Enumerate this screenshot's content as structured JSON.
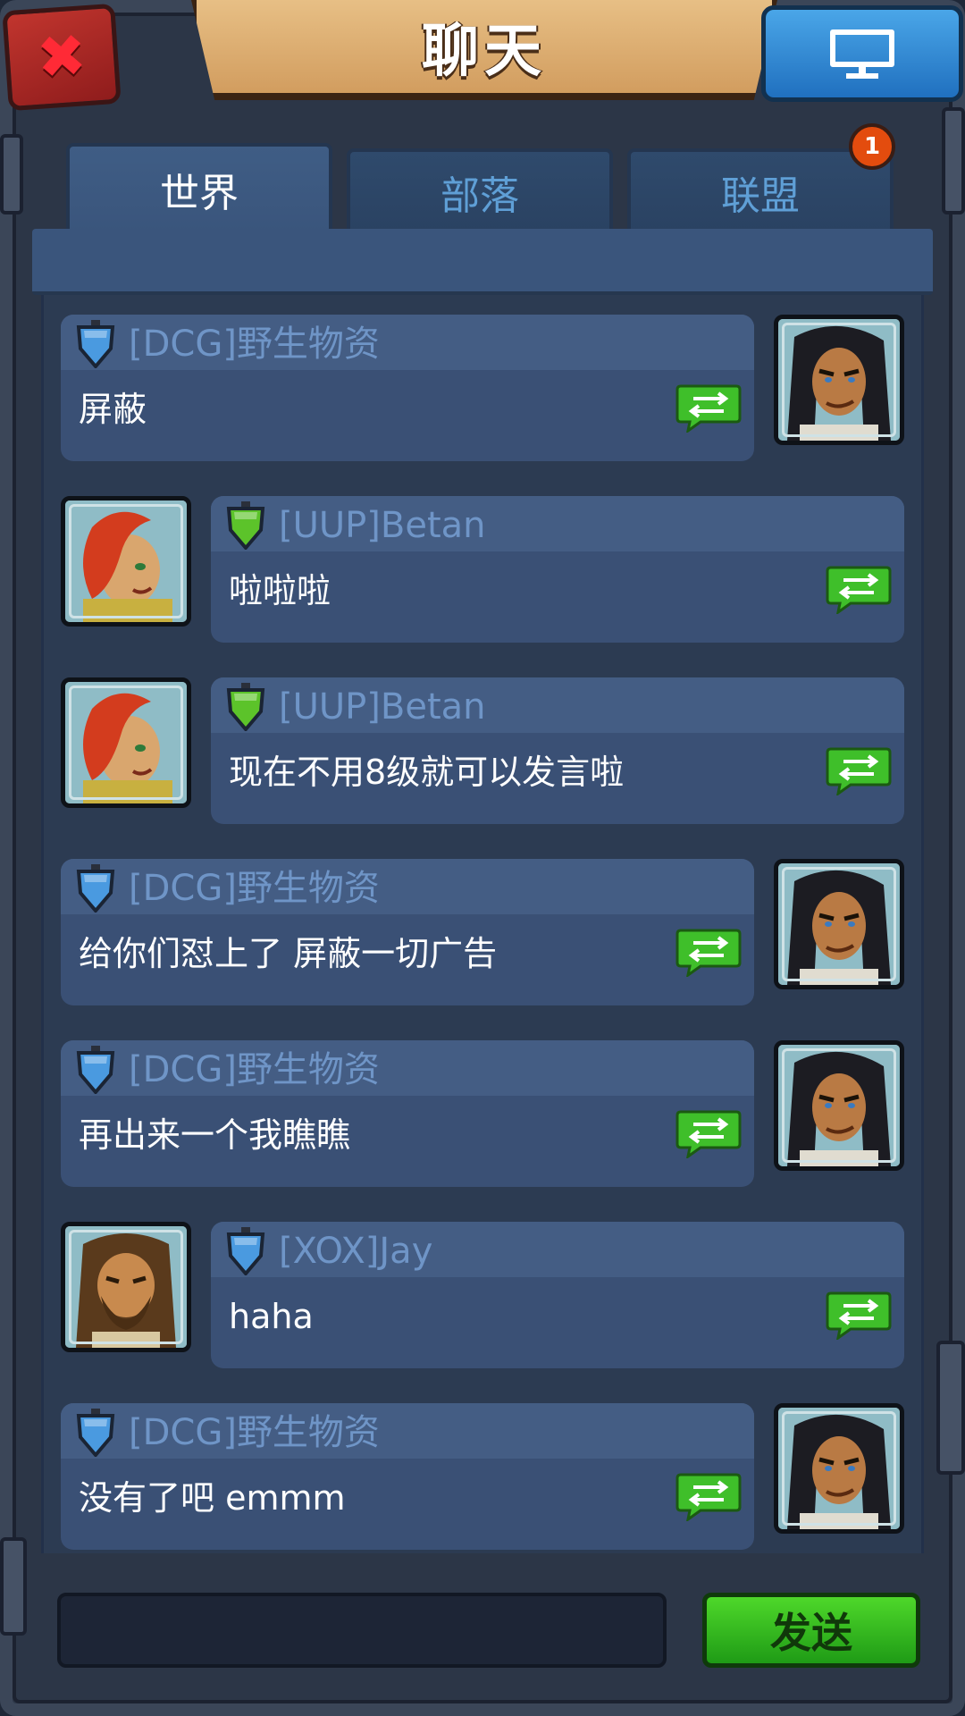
{
  "header": {
    "title": "聊天",
    "close_icon": "close-icon",
    "monitor_icon": "monitor-icon"
  },
  "tabs": [
    {
      "label": "世界",
      "active": true
    },
    {
      "label": "部落",
      "active": false
    },
    {
      "label": "联盟",
      "active": false,
      "badge": "1"
    }
  ],
  "messages": [
    {
      "side": "left-bubble",
      "name": "[DCG]野生物资",
      "text": "屏蔽",
      "shield_color": "#4a9ae0",
      "avatar": "dark-hair-warrior-avatar"
    },
    {
      "side": "right-bubble",
      "name": "[UUP]Betan",
      "text": "啦啦啦",
      "shield_color": "#5cc32a",
      "avatar": "red-hair-woman-avatar"
    },
    {
      "side": "right-bubble",
      "name": "[UUP]Betan",
      "text": "现在不用8级就可以发言啦",
      "shield_color": "#5cc32a",
      "avatar": "red-hair-woman-avatar"
    },
    {
      "side": "left-bubble",
      "name": "[DCG]野生物资",
      "text": "给你们怼上了 屏蔽一切广告",
      "shield_color": "#4a9ae0",
      "avatar": "dark-hair-warrior-avatar"
    },
    {
      "side": "left-bubble",
      "name": "[DCG]野生物资",
      "text": "再出来一个我瞧瞧",
      "shield_color": "#4a9ae0",
      "avatar": "dark-hair-warrior-avatar"
    },
    {
      "side": "right-bubble",
      "name": "[XOX]Jay",
      "text": "haha",
      "shield_color": "#4a9ae0",
      "avatar": "bearded-barbarian-avatar"
    },
    {
      "side": "left-bubble",
      "name": "[DCG]野生物资",
      "text": "没有了吧   emmm",
      "shield_color": "#4a9ae0",
      "avatar": "dark-hair-warrior-avatar"
    }
  ],
  "input": {
    "value": "",
    "placeholder": ""
  },
  "send_button": {
    "label": "发送"
  },
  "colors": {
    "bubble_bg": "#3a5075",
    "bubble_head": "#445d84",
    "name_color": "#6f95c7",
    "share_green": "#3fbf2a",
    "send_green": "#2fb51f",
    "badge_orange": "#e34c0e"
  }
}
